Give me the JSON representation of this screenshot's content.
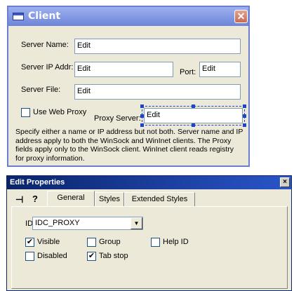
{
  "client": {
    "title": "Client",
    "close_glyph": "✕",
    "server_name_label": "Server Name:",
    "server_name_value": "Edit",
    "server_ip_label": "Server IP Addr:",
    "server_ip_value": "Edit",
    "port_label": "Port:",
    "port_value": "Edit",
    "server_file_label": "Server File:",
    "server_file_value": "Edit",
    "use_web_proxy_label": "Use Web Proxy",
    "proxy_server_label": "Proxy Server:",
    "proxy_server_value": "Edit",
    "info_text": "Specify either a name or IP address but not both. Server name and IP address apply to both the WinSock and WinInet clients. The Proxy fields apply only to the WinSock client. WinInet client reads registry for proxy information."
  },
  "props": {
    "title": "Edit Properties",
    "close_glyph": "×",
    "pin_glyph": "⊣",
    "help_glyph": "?",
    "tabs": [
      "General",
      "Styles",
      "Extended Styles"
    ],
    "id_label": "ID:",
    "id_value": "IDC_PROXY",
    "checkboxes": {
      "visible": {
        "label": "Visible",
        "checked": true
      },
      "group": {
        "label": "Group",
        "checked": false
      },
      "help_id": {
        "label": "Help ID",
        "checked": false
      },
      "disabled": {
        "label": "Disabled",
        "checked": false
      },
      "tab_stop": {
        "label": "Tab stop",
        "checked": true
      }
    },
    "check_glyph": "✔",
    "dropdown_glyph": "▼"
  }
}
